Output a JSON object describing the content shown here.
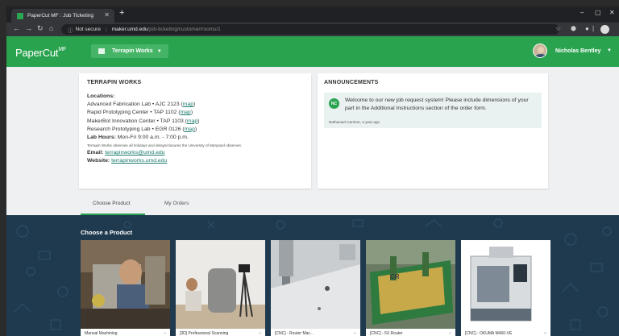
{
  "browser": {
    "tab_title": "PaperCut MF : Job Ticketing",
    "tab_close": "✕",
    "new_tab": "+",
    "security_label": "Not secure",
    "url_host": "maker.umd.edu",
    "url_path": "/job-ticketing/customer/rooms/1"
  },
  "app": {
    "brand_main": "PaperCut",
    "brand_suffix": "MF",
    "location_selector": "Terrapin Works",
    "user_name": "Nicholas Bentley",
    "accent_color": "#2aa34f"
  },
  "info_card": {
    "title": "TERRAPIN WORKS",
    "locations_label": "Locations:",
    "locations": [
      {
        "text": "Advanced Fabrication Lab • AJC 2123 (",
        "link": "map",
        "close": ")"
      },
      {
        "text": "Rapid Prototyping Center • TAP 1102 (",
        "link": "map",
        "close": ")"
      },
      {
        "text": "MakerBot Innovation Center • TAP 1103 (",
        "link": "map",
        "close": ")"
      },
      {
        "text": "Research Prototyping Lab • EGR 0126 (",
        "link": "map",
        "close": ")"
      }
    ],
    "hours_label": "Lab Hours:",
    "hours_value": "Mon-Fri 9:00 a.m. - 7:00 p.m.",
    "holiday_note": "Terrapin Works observes all holidays and delays/closures the University of Maryland observes.",
    "email_label": "Email:",
    "email_value": "terrapinworks@umd.edu",
    "website_label": "Website:",
    "website_value": "terrapinworks.umd.edu"
  },
  "announcements": {
    "title": "ANNOUNCEMENTS",
    "badge": "NC",
    "message": "Welcome to our new job request system! Please include dimensions of your part in the Additional Instructions section of the order form.",
    "meta": "Nathanael Carriere, a year ago"
  },
  "tabs": [
    "Choose Product",
    "My Orders"
  ],
  "products_section": {
    "title": "Choose a Product",
    "items": [
      {
        "caption": "Manual Machining",
        "image": "machinist-lathe"
      },
      {
        "caption": "[3D] Professional Scanning",
        "image": "3d-scanning"
      },
      {
        "caption": "[CNC] - Router Mac...",
        "image": "router-mill"
      },
      {
        "caption": "[CNC] - 5X Router",
        "image": "cnc-router-bed"
      },
      {
        "caption": "[CNC] - OKUMA M460-VE",
        "image": "okuma-mill"
      }
    ]
  }
}
